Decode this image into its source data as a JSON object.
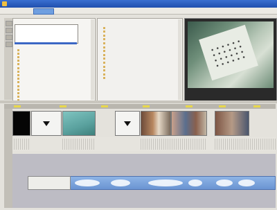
{
  "app": {
    "title": "",
    "accent": "#2a5cc0"
  },
  "menus": [
    "",
    "",
    "",
    "",
    ""
  ],
  "browser": {
    "tree_items": [
      "",
      "",
      "",
      "",
      "",
      "",
      "",
      "",
      "",
      "",
      "",
      "",
      "",
      "",
      ""
    ],
    "file_items": [
      "",
      "",
      "",
      "",
      "",
      "",
      "",
      "",
      "",
      "",
      "",
      "",
      "",
      ""
    ]
  },
  "monitor": {
    "caption": ""
  },
  "timeline": {
    "clips": [
      {
        "kind": "black"
      },
      {
        "kind": "transition"
      },
      {
        "kind": "video"
      },
      {
        "kind": "transition"
      },
      {
        "kind": "video"
      },
      {
        "kind": "video"
      },
      {
        "kind": "video"
      }
    ],
    "audio_clip_color": "#7aa2dc",
    "marker_color": "#e8d84c"
  }
}
